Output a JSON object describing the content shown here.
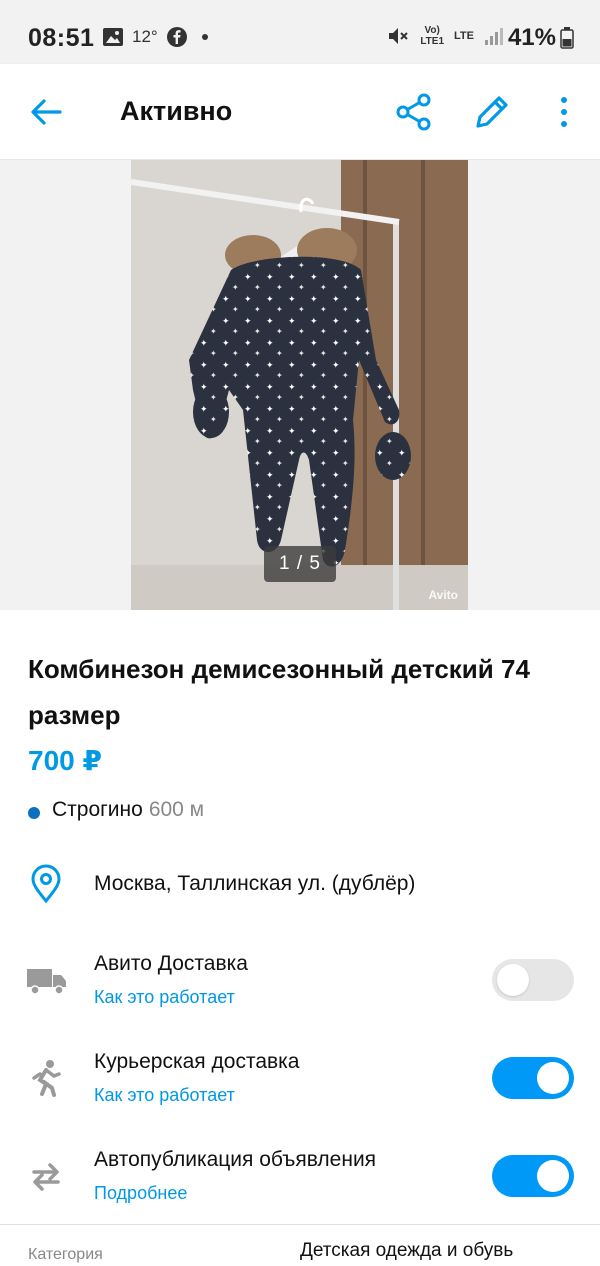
{
  "status_bar": {
    "time": "08:51",
    "temperature": "12°",
    "network_label": "LTE",
    "battery": "41%"
  },
  "app_bar": {
    "title": "Активно"
  },
  "gallery": {
    "counter": "1 / 5",
    "watermark": "Avito"
  },
  "listing": {
    "title": "Комбинезон демисезонный детский 74 размер",
    "price": "700 ₽",
    "metro_station": "Строгино",
    "metro_distance": "600 м",
    "address": "Москва, Таллинская ул. (дублёр)"
  },
  "options": [
    {
      "label": "Авито Доставка",
      "link": "Как это работает",
      "enabled": false,
      "icon": "truck-icon"
    },
    {
      "label": "Курьерская доставка",
      "link": "Как это работает",
      "enabled": true,
      "icon": "courier-icon"
    },
    {
      "label": "Автопубликация объявления",
      "link": "Подробнее",
      "enabled": true,
      "icon": "autopublish-icon"
    }
  ],
  "details": {
    "category_label": "Категория",
    "category_value": "Детская одежда и обувь"
  },
  "colors": {
    "accent": "#0099e5",
    "toggle_on": "#0099f7",
    "metro_dot": "#0b6fc1"
  }
}
